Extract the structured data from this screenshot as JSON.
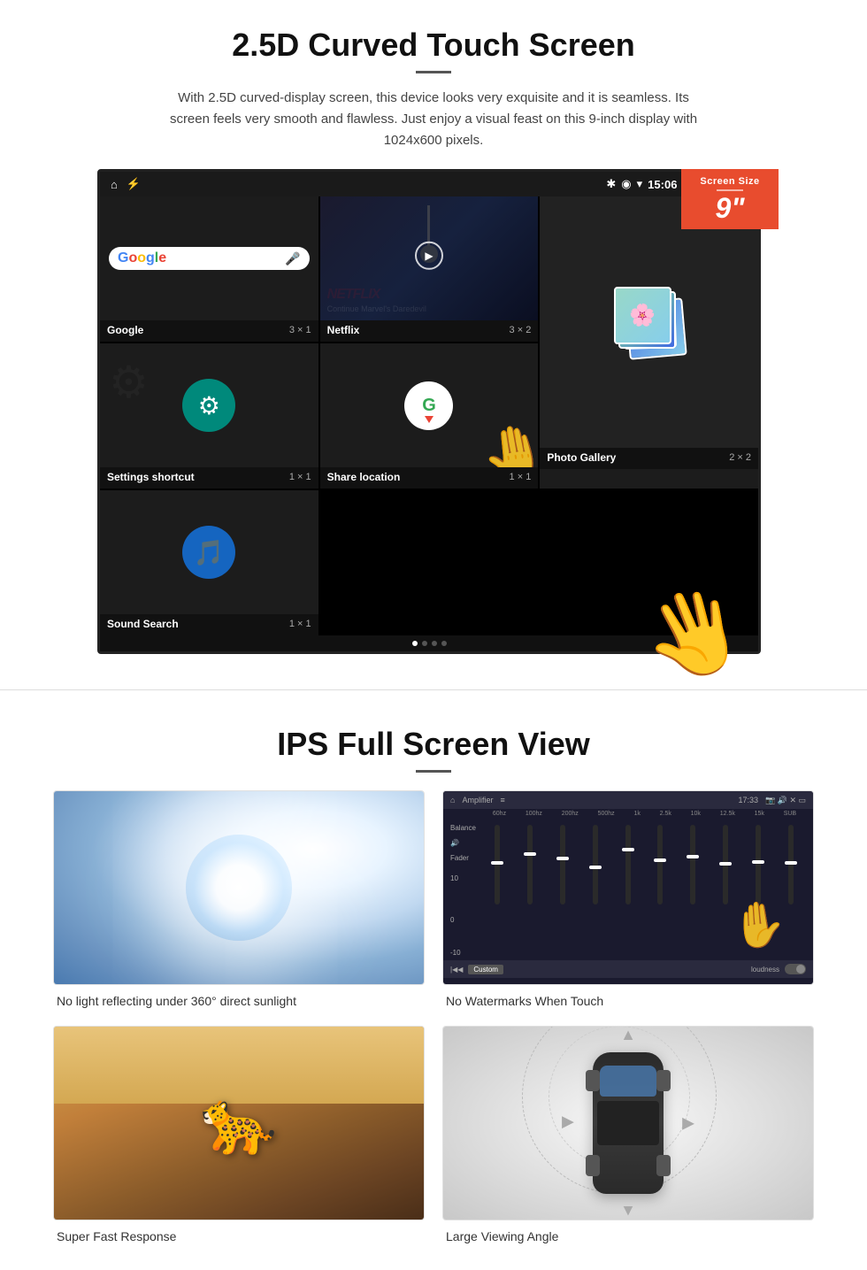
{
  "section1": {
    "title": "2.5D Curved Touch Screen",
    "description": "With 2.5D curved-display screen, this device looks very exquisite and it is seamless. Its screen feels very smooth and flawless. Just enjoy a visual feast on this 9-inch display with 1024x600 pixels.",
    "screen_badge": {
      "title": "Screen Size",
      "size": "9\""
    },
    "status_bar": {
      "time": "15:06"
    },
    "apps": [
      {
        "name": "Google",
        "size": "3 × 1"
      },
      {
        "name": "Netflix",
        "size": "3 × 2",
        "subtitle": "Continue Marvel's Daredevil"
      },
      {
        "name": "Photo Gallery",
        "size": "2 × 2"
      },
      {
        "name": "Settings shortcut",
        "size": "1 × 1"
      },
      {
        "name": "Share location",
        "size": "1 × 1"
      },
      {
        "name": "Sound Search",
        "size": "1 × 1"
      }
    ]
  },
  "section2": {
    "title": "IPS Full Screen View",
    "features": [
      {
        "label": "No light reflecting under 360° direct sunlight",
        "type": "sunlight"
      },
      {
        "label": "No Watermarks When Touch",
        "type": "amplifier"
      },
      {
        "label": "Super Fast Response",
        "type": "cheetah"
      },
      {
        "label": "Large Viewing Angle",
        "type": "car"
      }
    ]
  }
}
